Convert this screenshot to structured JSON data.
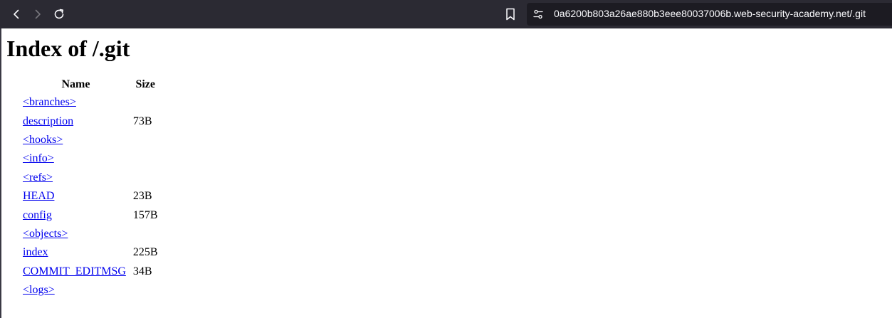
{
  "browser": {
    "url": "0a6200b803a26ae880b3eee80037006b.web-security-academy.net/.git",
    "back_icon": "back-arrow-icon",
    "forward_icon": "forward-arrow-icon",
    "reload_icon": "reload-icon",
    "bookmark_icon": "bookmark-icon",
    "site_info_icon": "site-info-icon"
  },
  "page": {
    "title": "Index of /.git",
    "columns": {
      "name": "Name",
      "size": "Size"
    },
    "entries": [
      {
        "name": "<branches>",
        "size": ""
      },
      {
        "name": "description",
        "size": "73B"
      },
      {
        "name": "<hooks>",
        "size": ""
      },
      {
        "name": "<info>",
        "size": ""
      },
      {
        "name": "<refs>",
        "size": ""
      },
      {
        "name": "HEAD",
        "size": "23B"
      },
      {
        "name": "config",
        "size": "157B"
      },
      {
        "name": "<objects>",
        "size": ""
      },
      {
        "name": "index",
        "size": "225B"
      },
      {
        "name": "COMMIT_EDITMSG",
        "size": "34B"
      },
      {
        "name": "<logs>",
        "size": ""
      }
    ]
  },
  "colors": {
    "toolbar_bg": "#2b2a33",
    "urlbar_bg": "#1c1b22",
    "link": "#0000ee"
  }
}
